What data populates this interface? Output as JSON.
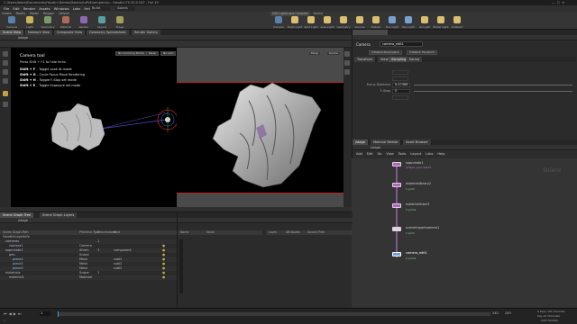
{
  "titlebar": {
    "text": "C:/Users/team/Documents/Houdini Demos/Solaris/LoPsExample.hip - Houdini FX 20.0.547 - Full 19"
  },
  "menubar": {
    "items": [
      "File",
      "Edit",
      "Render",
      "Assets",
      "Windows",
      "Labs",
      "Help"
    ],
    "build": "Build",
    "context": "Solaris"
  },
  "shelf": {
    "tabs": [
      "Create",
      "Modify",
      "Model",
      "Polygon",
      "Deform"
    ],
    "tools": [
      "Camera",
      "Light",
      "Geometry",
      "Material",
      "Render",
      "Layout",
      "Stage"
    ],
    "right_tabs": [
      "USD Lights and Cameras",
      "Karma"
    ],
    "right_tools": [
      "Camera",
      "Point Light",
      "Spot Light",
      "Area Light",
      "Geometry Light",
      "Volume Light",
      "Distant Light",
      "Env Light",
      "Sky Light",
      "GI Light",
      "Portal Light",
      "Ambient"
    ]
  },
  "viewport": {
    "tabs": [
      "Scene View",
      "Network View",
      "Composite View",
      "Geometry Spreadsheet",
      "Render Gallery"
    ],
    "path": "/stage",
    "tool_title": "Camera tool",
    "tool_hint": "Press Shift + F1 to hide hints.",
    "hotkeys": [
      {
        "key": "Shift + F",
        "desc": "Toggle Look At mode"
      },
      {
        "key": "Shift + G",
        "desc": "Cycle Focus Plane Rendering"
      },
      {
        "key": "Shift + H",
        "desc": "Toggle F-Stop set mode"
      },
      {
        "key": "Shift + E",
        "desc": "Toggle Exposure set mode"
      }
    ],
    "left_buttons": [
      "No Incoming Points",
      "Persp",
      "No cam"
    ],
    "right_buttons": [
      "Persp",
      "Karma"
    ]
  },
  "params": {
    "type": "Camera",
    "name": "camera_edit1",
    "tabs_top": [
      "Initialize Parameters",
      "Initialize Transform"
    ],
    "tabs": [
      "Transform",
      "View",
      "Sampling",
      "Karma"
    ],
    "rows": [
      {
        "label": "Focus Distance",
        "value": "6.47468"
      },
      {
        "label": "F-Stop",
        "value": "0"
      }
    ]
  },
  "network": {
    "tabs": [
      "/stage",
      "Material Palette",
      "Asset Browser"
    ],
    "path": "/stage",
    "menu": [
      "Add",
      "Edit",
      "Go",
      "View",
      "Tools",
      "Layout",
      "Labs",
      "Help"
    ],
    "watermark": "Solaris",
    "nodes": [
      {
        "name": "sopcreate1",
        "sub": "/shape_sopcreate1"
      },
      {
        "name": "materiallibrary2",
        "sub": "1 prim"
      },
      {
        "name": "materiallinker2",
        "sub": "2 prims"
      },
      {
        "name": "sceneimportcamera1",
        "sub": "1 prim"
      },
      {
        "name": "camera_edit1",
        "sub": "2 prims"
      }
    ]
  },
  "scene_graph": {
    "tabs": [
      "Scene Graph Tree",
      "Scene Graph Layers"
    ],
    "path": "/stage",
    "columns": [
      "Scene Graph Path",
      "Primitive Type",
      "Descendants",
      "Kind"
    ],
    "rows": [
      {
        "path": "HoudiniLayerInfo",
        "type": "",
        "desc": "",
        "kind": ""
      },
      {
        "path": "cameras",
        "type": "",
        "desc": "1",
        "kind": ""
      },
      {
        "path": "camera1",
        "type": "Camera",
        "desc": "",
        "kind": ""
      },
      {
        "path": "sopcreate1",
        "type": "Xform",
        "desc": "3",
        "kind": "component"
      },
      {
        "path": "geo",
        "type": "Scope",
        "desc": "",
        "kind": ""
      },
      {
        "path": "piece1",
        "type": "Mesh",
        "desc": "",
        "kind": "subD"
      },
      {
        "path": "piece2",
        "type": "Mesh",
        "desc": "",
        "kind": "subD"
      },
      {
        "path": "piece3",
        "type": "Mesh",
        "desc": "",
        "kind": "subD"
      },
      {
        "path": "materials",
        "type": "Scope",
        "desc": "1",
        "kind": ""
      },
      {
        "path": "material1",
        "type": "Material",
        "desc": "",
        "kind": ""
      }
    ]
  },
  "scene_detail": {
    "columns": [
      "Name",
      "Value"
    ],
    "columns2": [
      "Layer",
      "Attributes",
      "Source Prim"
    ]
  },
  "timeline": {
    "frame": "1",
    "start": "1",
    "end": "240",
    "end2": "240",
    "keys_label": "0 keys, 0/0 channels",
    "key_all": "Key All Channels",
    "auto": "Auto Update"
  }
}
